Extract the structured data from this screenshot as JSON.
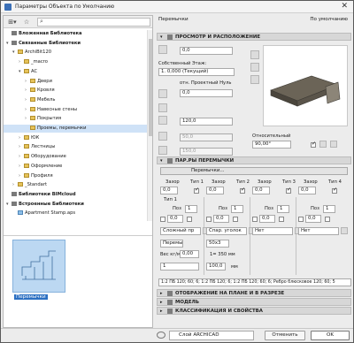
{
  "window": {
    "title": "Параметры Объекта по Умолчанию",
    "close": "✕"
  },
  "left_panel": {
    "toolbar": {
      "lib_btn": "⊞▾",
      "fav_btn": "☆",
      "search_icon": "⌕",
      "search_placeholder": ""
    },
    "tree": [
      {
        "label": "Вложенная Библиотека",
        "bold": true,
        "indent": 0,
        "tri": "",
        "icon": "lib"
      },
      {
        "label": "Связанные Библиотеки",
        "bold": true,
        "indent": 0,
        "tri": "▾",
        "icon": "lib"
      },
      {
        "label": "ArchiBit120",
        "bold": false,
        "indent": 1,
        "tri": "▾",
        "icon": "fold"
      },
      {
        "label": "_macro",
        "bold": false,
        "indent": 2,
        "tri": "›",
        "icon": "fold"
      },
      {
        "label": "AC",
        "bold": false,
        "indent": 2,
        "tri": "▾",
        "icon": "fold"
      },
      {
        "label": "Двери",
        "bold": false,
        "indent": 3,
        "tri": "›",
        "icon": "fold"
      },
      {
        "label": "Кровля",
        "bold": false,
        "indent": 3,
        "tri": "›",
        "icon": "fold"
      },
      {
        "label": "Мебель",
        "bold": false,
        "indent": 3,
        "tri": "›",
        "icon": "fold"
      },
      {
        "label": "Навесные стены",
        "bold": false,
        "indent": 3,
        "tri": "›",
        "icon": "fold"
      },
      {
        "label": "Покрытия",
        "bold": false,
        "indent": 3,
        "tri": "›",
        "icon": "fold"
      },
      {
        "label": "Проемы, перемычки",
        "bold": false,
        "indent": 3,
        "tri": "",
        "icon": "fold",
        "selected": true
      },
      {
        "label": "ЮК",
        "bold": false,
        "indent": 2,
        "tri": "›",
        "icon": "fold"
      },
      {
        "label": "Лестницы",
        "bold": false,
        "indent": 2,
        "tri": "›",
        "icon": "fold"
      },
      {
        "label": "Оборудование",
        "bold": false,
        "indent": 2,
        "tri": "›",
        "icon": "fold"
      },
      {
        "label": "Оформление",
        "bold": false,
        "indent": 2,
        "tri": "›",
        "icon": "fold"
      },
      {
        "label": "Профиля",
        "bold": false,
        "indent": 2,
        "tri": "›",
        "icon": "fold"
      },
      {
        "label": "_Standart",
        "bold": false,
        "indent": 1,
        "tri": "›",
        "icon": "fold"
      },
      {
        "label": "Библиотеки BIMcloud",
        "bold": true,
        "indent": 0,
        "tri": "",
        "icon": "lib"
      },
      {
        "label": "Встроенные Библиотеки",
        "bold": true,
        "indent": 0,
        "tri": "▾",
        "icon": "lib"
      },
      {
        "label": "Apartment Stamp.aps",
        "bold": false,
        "indent": 1,
        "tri": "",
        "icon": "obj"
      }
    ],
    "preview_item": "Перемычки"
  },
  "right_panel": {
    "object_name": "Перемычки",
    "default_label": "По умолчанию",
    "section_preview": "ПРОСМОТР И РАСПОЛОЖЕНИЕ",
    "sections": {
      "lintel": "ПАР.РЫ ПЕРЕМЫЧКИ",
      "floor_plan": "ОТОБРАЖЕНИЕ НА ПЛАНЕ И В РАЗРЕЗЕ",
      "model": "МОДЕЛЬ",
      "classification": "КЛАССИФИКАЦИЯ И СВОЙСТВА"
    },
    "placement": {
      "field1": "0,0",
      "home_story_label": "Собственный Этаж:",
      "home_story_value": "1. 0,000 (Текущий)",
      "rel_label": "отн. Проектный Нуль",
      "rel_value": "0,0",
      "thickness": "120,0",
      "dim1": "50,0",
      "dim2": "150,0",
      "relative_label": "Относительный",
      "angle": "90,00°"
    },
    "lintel": {
      "selector": "Перемычки...",
      "headers": [
        "Зазор",
        "Тип 1",
        "Зазор",
        "Тип 2",
        "Зазор",
        "Тип 3",
        "Зазор",
        "Тип 4"
      ],
      "gaps": [
        "0,0",
        "0,0",
        "0,0",
        "0,0"
      ],
      "type1": "Тип 1",
      "pos_label": "Поз",
      "pos_values": [
        "1",
        "1",
        "1",
        "1"
      ],
      "zeros": [
        "0,0",
        "0,0",
        "0,0",
        "0,0"
      ],
      "dropdowns": [
        "Сложный пр",
        "Спар. уголок",
        "Нет",
        "Нет"
      ],
      "dropdowns2": [
        "Перемы...",
        "50х3"
      ],
      "weight_label": "Вес кг/м",
      "weight_value": "0,00",
      "size_label": "1= 350 мм",
      "size_field": "100,0",
      "mm": "мм",
      "footer": "1:2 ПБ 120; 60; 6; 1:2 ПБ 120; 6; 1:2 ПБ 120; 60; 6; Ребро блюсковое 120; 60; 5"
    }
  },
  "bottom": {
    "layer": "Слой ARCHICAD",
    "cancel": "Отменить",
    "ok": "OK"
  }
}
